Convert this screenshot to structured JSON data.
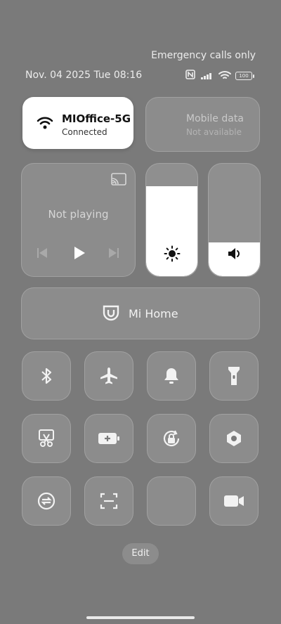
{
  "status": {
    "top_right": "Emergency calls only",
    "date_time": "Nov. 04 2025 Tue 08:16",
    "battery": "100"
  },
  "wifi": {
    "name": "MIOffice-5G",
    "state": "Connected"
  },
  "mobile_data": {
    "title": "Mobile data",
    "state": "Not available"
  },
  "media": {
    "state": "Not playing"
  },
  "brightness": {
    "level_percent": 80
  },
  "volume": {
    "level_percent": 30
  },
  "mihome": {
    "label": "Mi Home"
  },
  "edit": {
    "label": "Edit"
  }
}
